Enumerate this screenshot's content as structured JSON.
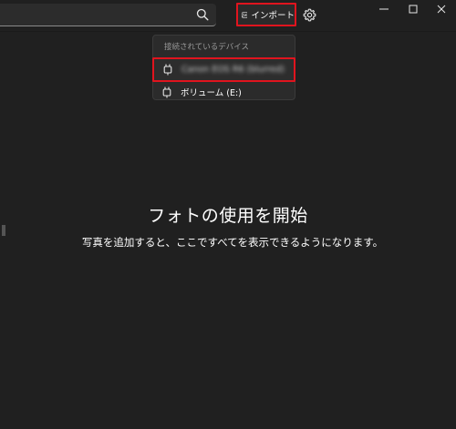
{
  "search": {
    "value": "",
    "placeholder": ""
  },
  "toolbar": {
    "import_label": "インポート",
    "import_icon": "photo-import-icon",
    "settings_icon": "gear-icon"
  },
  "window_controls": {
    "minimize_icon": "minimize-icon",
    "maximize_icon": "maximize-icon",
    "close_icon": "close-icon"
  },
  "import_menu": {
    "header": "接続されているデバイス",
    "devices": [
      {
        "label": "Canon EOS R6 (blurred)",
        "icon": "device-icon",
        "blurred": true
      },
      {
        "label": "ボリューム (E:)",
        "icon": "device-icon",
        "blurred": false
      }
    ]
  },
  "empty_state": {
    "title": "フォトの使用を開始",
    "subtitle": "写真を追加すると、ここですべてを表示できるようになります。"
  },
  "colors": {
    "background": "#202020",
    "highlight_border": "#e0141e",
    "menu_background": "#2b2b2b",
    "muted_text": "#9a9a9a"
  }
}
